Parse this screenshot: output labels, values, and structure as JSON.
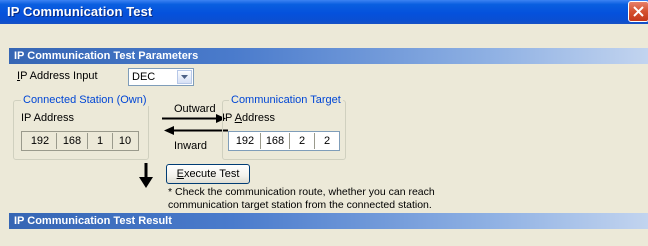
{
  "window": {
    "title": "IP Communication Test"
  },
  "params": {
    "header": "IP Communication Test Parameters",
    "ip_input_label": "IP Address Input",
    "ip_input_value": "DEC"
  },
  "connected_station": {
    "legend": "Connected Station (Own)",
    "ip_label": "IP Address",
    "octets": [
      "192",
      "168",
      "1",
      "10"
    ]
  },
  "direction": {
    "outward": "Outward",
    "inward": "Inward"
  },
  "target": {
    "legend": "Communication Target",
    "ip_label": "IP Address",
    "octets": [
      "192",
      "168",
      "2",
      "2"
    ]
  },
  "execute_button": "Execute Test",
  "note_line1": "* Check the communication route, whether you can reach",
  "note_line2": "communication target station from the connected station.",
  "result": {
    "header": "IP Communication Test Result"
  },
  "colors": {
    "titlebar": "#0551dc",
    "section_bar": "#3666b4",
    "group_legend": "#0046d5"
  }
}
